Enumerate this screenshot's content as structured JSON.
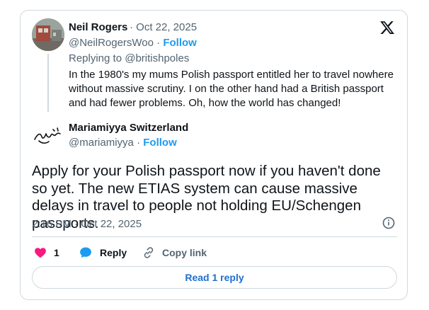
{
  "quoted_post": {
    "author_name": "Neil Rogers",
    "date_prefix": " · Oct 22, 2025",
    "handle": "@NeilRogersWoo",
    "follow_sep": " · ",
    "follow_label": "Follow",
    "replying_prefix": "Replying to ",
    "replying_to": "@britishpoles",
    "text": "In the 1980's my mums Polish passport entitled her to travel nowhere without massive scrutiny. I on the other hand had a British passport and had fewer problems. Oh, how the world has changed!"
  },
  "main_post": {
    "author_name": "Mariamiyya Switzerland",
    "handle": "@mariamiyya",
    "follow_sep": " · ",
    "follow_label": "Follow",
    "text": "Apply for your Polish passport now if you haven't done so yet. The new ETIAS system can cause massive delays in travel to people not holding EU/Schengen passports.",
    "timestamp": "2:16 PM · Oct 22, 2025"
  },
  "actions": {
    "like_count": "1",
    "reply_label": "Reply",
    "copy_link_label": "Copy link"
  },
  "read_replies_label": "Read 1 reply",
  "icons": [
    "x-logo-icon",
    "info-icon",
    "heart-icon",
    "reply-bubble-icon",
    "link-icon"
  ],
  "colors": {
    "accent": "#1d9bf0",
    "like": "#f91880",
    "secondary_text": "#536471",
    "border": "#cfd9de"
  }
}
